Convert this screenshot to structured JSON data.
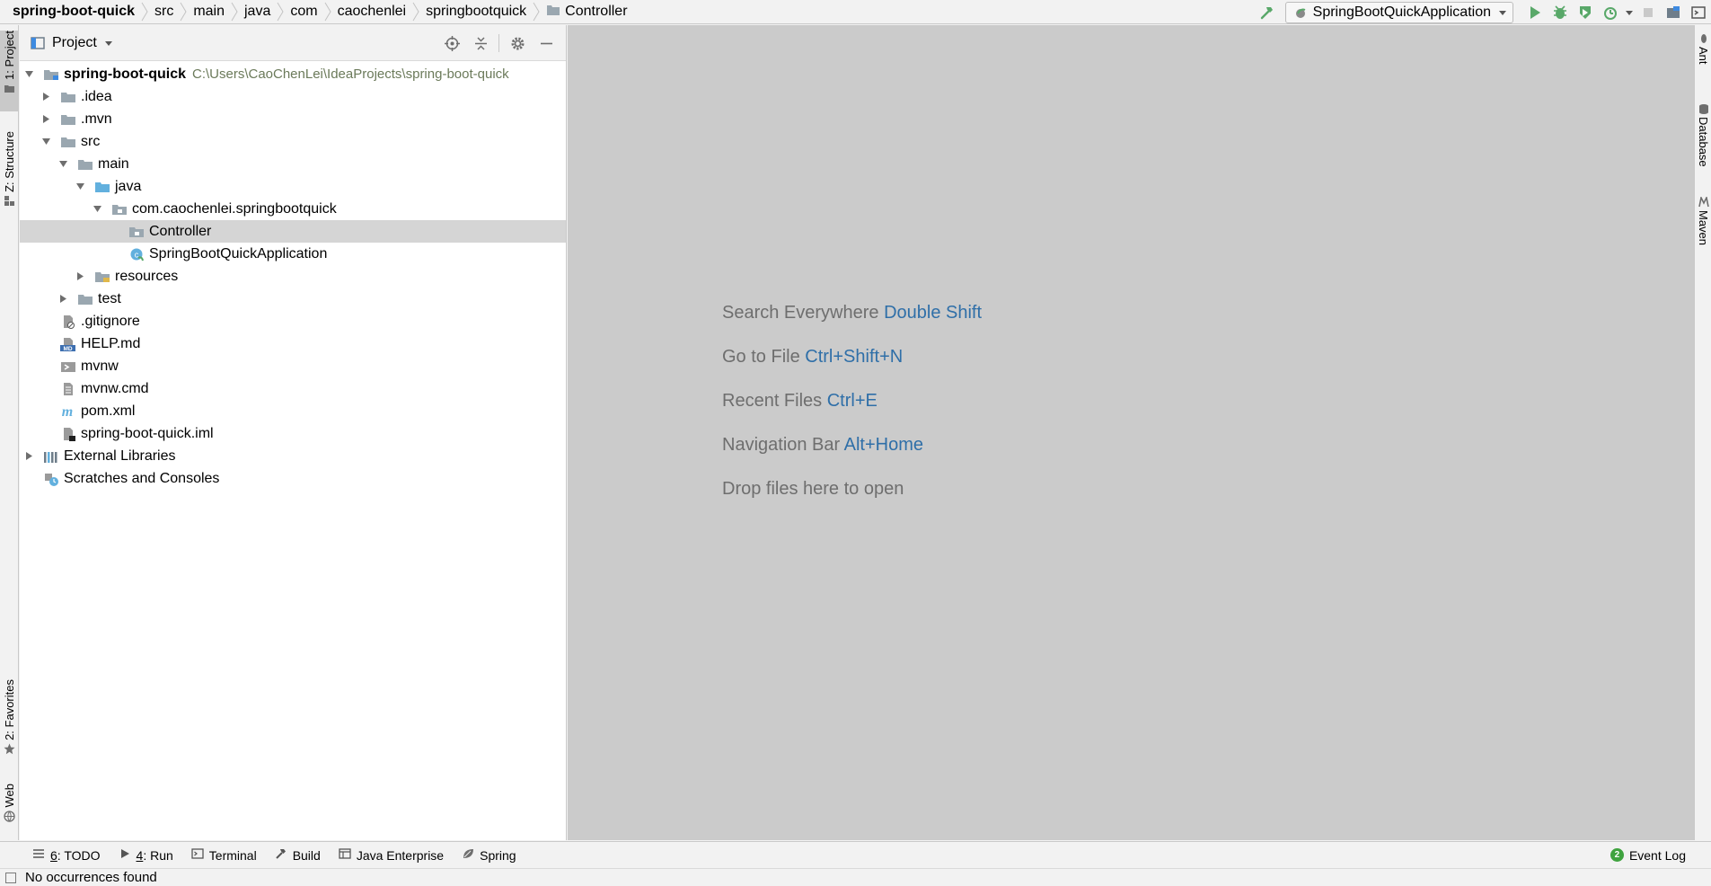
{
  "breadcrumbs": [
    {
      "label": "spring-boot-quick",
      "root": true
    },
    {
      "label": "src"
    },
    {
      "label": "main"
    },
    {
      "label": "java"
    },
    {
      "label": "com"
    },
    {
      "label": "caochenlei"
    },
    {
      "label": "springbootquick"
    },
    {
      "label": "Controller",
      "folder_icon": true
    }
  ],
  "toolbar": {
    "run_config": "SpringBootQuickApplication",
    "buttons": [
      "build-hammer-icon",
      "run-icon",
      "debug-icon",
      "coverage-icon",
      "profile-icon",
      "stop-icon",
      "project-structure-icon",
      "terminal-window-icon"
    ]
  },
  "left_tabs": {
    "project": "1: Project",
    "structure": "Z: Structure",
    "favorites": "2: Favorites",
    "web": "Web"
  },
  "right_tabs": {
    "ant": "Ant",
    "database": "Database",
    "maven": "Maven"
  },
  "panel": {
    "title": "Project"
  },
  "tree": [
    {
      "name": "spring-boot-quick",
      "path": "C:\\Users\\CaoChenLei\\IdeaProjects\\spring-boot-quick",
      "depth": 0,
      "expanded": true,
      "icon": "module",
      "bold": true
    },
    {
      "name": ".idea",
      "depth": 1,
      "expanded": false,
      "icon": "folder"
    },
    {
      "name": ".mvn",
      "depth": 1,
      "expanded": false,
      "icon": "folder"
    },
    {
      "name": "src",
      "depth": 1,
      "expanded": true,
      "icon": "folder"
    },
    {
      "name": "main",
      "depth": 2,
      "expanded": true,
      "icon": "folder"
    },
    {
      "name": "java",
      "depth": 3,
      "expanded": true,
      "icon": "source-folder"
    },
    {
      "name": "com.caochenlei.springbootquick",
      "depth": 4,
      "expanded": true,
      "icon": "package"
    },
    {
      "name": "Controller",
      "depth": 5,
      "leaf": true,
      "icon": "package",
      "selected": true
    },
    {
      "name": "SpringBootQuickApplication",
      "depth": 5,
      "leaf": true,
      "icon": "spring-class"
    },
    {
      "name": "resources",
      "depth": 3,
      "expanded": false,
      "icon": "resources-folder"
    },
    {
      "name": "test",
      "depth": 2,
      "expanded": false,
      "icon": "folder"
    },
    {
      "name": ".gitignore",
      "depth": 1,
      "leaf": true,
      "icon": "ignore-file"
    },
    {
      "name": "HELP.md",
      "depth": 1,
      "leaf": true,
      "icon": "markdown-file"
    },
    {
      "name": "mvnw",
      "depth": 1,
      "leaf": true,
      "icon": "script-file"
    },
    {
      "name": "mvnw.cmd",
      "depth": 1,
      "leaf": true,
      "icon": "text-file"
    },
    {
      "name": "pom.xml",
      "depth": 1,
      "leaf": true,
      "icon": "maven-file"
    },
    {
      "name": "spring-boot-quick.iml",
      "depth": 1,
      "leaf": true,
      "icon": "iml-file"
    },
    {
      "name": "External Libraries",
      "depth": 0,
      "expanded": false,
      "icon": "libraries"
    },
    {
      "name": "Scratches and Consoles",
      "depth": 0,
      "leaf": true,
      "icon": "scratches"
    }
  ],
  "editor_hints": [
    {
      "text": "Search Everywhere",
      "key": "Double Shift"
    },
    {
      "text": "Go to File",
      "key": "Ctrl+Shift+N"
    },
    {
      "text": "Recent Files",
      "key": "Ctrl+E"
    },
    {
      "text": "Navigation Bar",
      "key": "Alt+Home"
    },
    {
      "text": "Drop files here to open",
      "key": ""
    }
  ],
  "bottom_tabs": [
    {
      "num": "6",
      "label": ": TODO",
      "icon": "todo-icon"
    },
    {
      "num": "4",
      "label": ": Run",
      "icon": "run-icon"
    },
    {
      "num": "",
      "label": "Terminal",
      "icon": "terminal-icon"
    },
    {
      "num": "",
      "label": "Build",
      "icon": "build-hammer-icon"
    },
    {
      "num": "",
      "label": "Java Enterprise",
      "icon": "java-enterprise-icon"
    },
    {
      "num": "",
      "label": "Spring",
      "icon": "spring-leaf-icon"
    }
  ],
  "event_log": {
    "count": "2",
    "label": "Event Log"
  },
  "status": {
    "text": "No occurrences found"
  },
  "colors": {
    "chrome": "#f2f2f2",
    "editor_bg": "#cbcbcb",
    "selection": "#d5d5d5",
    "folder": "#9aa7b0",
    "source_folder": "#62b0de",
    "shortcut_key": "#2f6fa8",
    "run_green": "#59a869"
  }
}
